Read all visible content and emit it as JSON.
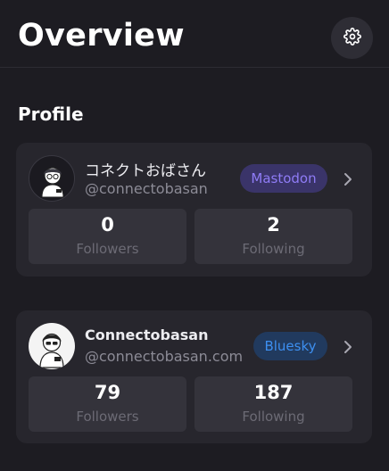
{
  "header": {
    "title": "Overview",
    "settings_icon": "gear-icon"
  },
  "profile_section": {
    "title": "Profile"
  },
  "accounts": [
    {
      "display_name": "コネクトおばさん",
      "handle": "@connectobasan",
      "service": "Mastodon",
      "service_color": "#8f7cf6",
      "followers_count": "0",
      "followers_label": "Followers",
      "following_count": "2",
      "following_label": "Following"
    },
    {
      "display_name": "Connectobasan",
      "handle": "@connectobasan.com",
      "service": "Bluesky",
      "service_color": "#3d8ff0",
      "followers_count": "79",
      "followers_label": "Followers",
      "following_count": "187",
      "following_label": "Following"
    }
  ]
}
